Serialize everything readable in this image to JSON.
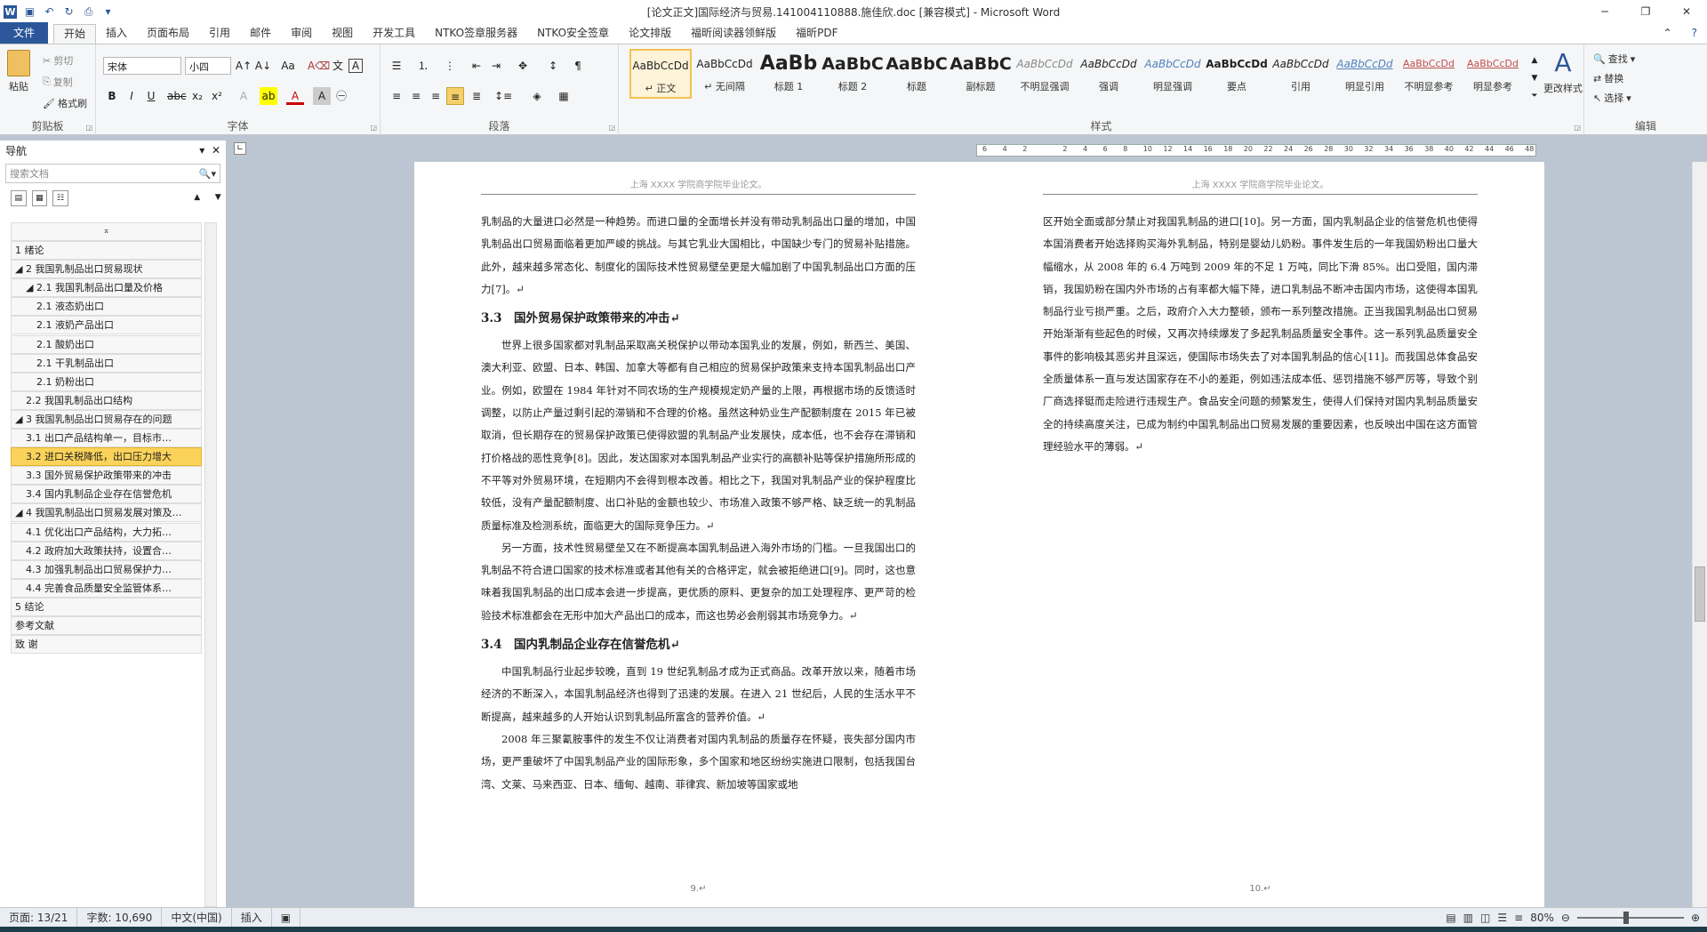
{
  "window": {
    "title": "[论文正文]国际经济与贸易.141004110888.施佳欣.doc [兼容模式] - Microsoft Word",
    "app_icon": "W"
  },
  "tabs": {
    "file": "文件",
    "items": [
      "开始",
      "插入",
      "页面布局",
      "引用",
      "邮件",
      "审阅",
      "视图",
      "开发工具",
      "NTKO签章服务器",
      "NTKO安全签章",
      "论文排版",
      "福昕阅读器领鲜版",
      "福昕PDF"
    ],
    "active_index": 0
  },
  "clipboard": {
    "paste": "粘贴",
    "cut": "剪切",
    "copy": "复制",
    "format_painter": "格式刷",
    "label": "剪贴板"
  },
  "font": {
    "name": "宋体",
    "size": "小四",
    "label": "字体"
  },
  "paragraph": {
    "label": "段落"
  },
  "styles": {
    "label": "样式",
    "items": [
      {
        "preview": "AaBbCcDd",
        "name": "↵ 正文",
        "selected": true
      },
      {
        "preview": "AaBbCcDd",
        "name": "↵ 无间隔",
        "selected": false
      },
      {
        "preview": "AaBb",
        "name": "标题 1",
        "selected": false
      },
      {
        "preview": "AaBbC",
        "name": "标题 2",
        "selected": false
      },
      {
        "preview": "AaBbC",
        "name": "标题",
        "selected": false
      },
      {
        "preview": "AaBbC",
        "name": "副标题",
        "selected": false
      },
      {
        "preview": "AaBbCcDd",
        "name": "不明显强调",
        "selected": false
      },
      {
        "preview": "AaBbCcDd",
        "name": "强调",
        "selected": false
      },
      {
        "preview": "AaBbCcDd",
        "name": "明显强调",
        "selected": false
      },
      {
        "preview": "AaBbCcDd",
        "name": "要点",
        "selected": false
      },
      {
        "preview": "AaBbCcDd",
        "name": "引用",
        "selected": false
      },
      {
        "preview": "AaBbCcDd",
        "name": "明显引用",
        "selected": false
      },
      {
        "preview": "AaBbCcDd",
        "name": "不明显参考",
        "selected": false
      },
      {
        "preview": "AaBbCcDd",
        "name": "明显参考",
        "selected": false
      }
    ],
    "change_styles": "更改样式"
  },
  "editing": {
    "find": "查找",
    "replace": "替换",
    "select": "选择",
    "label": "编辑"
  },
  "ruler": {
    "ticks": [
      "6",
      "4",
      "2",
      "",
      "2",
      "4",
      "6",
      "8",
      "10",
      "12",
      "14",
      "16",
      "18",
      "20",
      "22",
      "24",
      "26",
      "28",
      "30",
      "32",
      "34",
      "36",
      "38",
      "40",
      "42",
      "44",
      "46",
      "48"
    ]
  },
  "nav": {
    "title": "导航",
    "search_placeholder": "搜索文档",
    "items": [
      {
        "text": "1 绪论",
        "level": 1,
        "selected": false
      },
      {
        "text": "◢ 2 我国乳制品出口贸易现状",
        "level": 1,
        "selected": false
      },
      {
        "text": "◢ 2.1 我国乳制品出口量及价格",
        "level": 2,
        "selected": false
      },
      {
        "text": "2.1 液态奶出口",
        "level": 3,
        "selected": false
      },
      {
        "text": "2.1 液奶产品出口",
        "level": 3,
        "selected": false
      },
      {
        "text": "2.1 酸奶出口",
        "level": 3,
        "selected": false
      },
      {
        "text": "2.1 干乳制品出口",
        "level": 3,
        "selected": false
      },
      {
        "text": "2.1 奶粉出口",
        "level": 3,
        "selected": false
      },
      {
        "text": "2.2 我国乳制品出口结构",
        "level": 2,
        "selected": false
      },
      {
        "text": "◢ 3 我国乳制品出口贸易存在的问题",
        "level": 1,
        "selected": false
      },
      {
        "text": "3.1 出口产品结构单一，目标市…",
        "level": 2,
        "selected": false
      },
      {
        "text": "3.2 进口关税降低，出口压力增大",
        "level": 2,
        "selected": true
      },
      {
        "text": "3.3 国外贸易保护政策带来的冲击",
        "level": 2,
        "selected": false
      },
      {
        "text": "3.4 国内乳制品企业存在信誉危机",
        "level": 2,
        "selected": false
      },
      {
        "text": "◢ 4 我国乳制品出口贸易发展对策及…",
        "level": 1,
        "selected": false
      },
      {
        "text": "4.1 优化出口产品结构，大力拓…",
        "level": 2,
        "selected": false
      },
      {
        "text": "4.2 政府加大政策扶持，设置合…",
        "level": 2,
        "selected": false
      },
      {
        "text": "4.3 加强乳制品出口贸易保护力…",
        "level": 2,
        "selected": false
      },
      {
        "text": "4.4 完善食品质量安全监管体系…",
        "level": 2,
        "selected": false
      },
      {
        "text": "5 结论",
        "level": 1,
        "selected": false
      },
      {
        "text": "参考文献",
        "level": 1,
        "selected": false
      },
      {
        "text": "致 谢",
        "level": 1,
        "selected": false
      }
    ]
  },
  "page9": {
    "header": "上海 XXXX 学院商学院毕业论文。",
    "p1": "乳制品的大量进口必然是一种趋势。而进口量的全面增长并没有带动乳制品出口量的增加，中国乳制品出口贸易面临着更加严峻的挑战。与其它乳业大国相比，中国缺少专门的贸易补贴措施。此外，越来越多常态化、制度化的国际技术性贸易壁垒更是大幅加剧了中国乳制品出口方面的压力[7]。↵",
    "h33": "3.3　国外贸易保护政策带来的冲击↵",
    "p2": "世界上很多国家都对乳制品采取高关税保护以带动本国乳业的发展，例如，新西兰、美国、澳大利亚、欧盟、日本、韩国、加拿大等都有自己相应的贸易保护政策来支持本国乳制品出口产业。例如，欧盟在 1984 年针对不同农场的生产规模规定奶产量的上限，再根据市场的反馈适时调整，以防止产量过剩引起的滞销和不合理的价格。虽然这种奶业生产配额制度在 2015 年已被取消，但长期存在的贸易保护政策已使得欧盟的乳制品产业发展快，成本低，也不会存在滞销和打价格战的恶性竞争[8]。因此，发达国家对本国乳制品产业实行的高额补贴等保护措施所形成的不平等对外贸易环境，在短期内不会得到根本改善。相比之下，我国对乳制品产业的保护程度比较低，没有产量配额制度、出口补贴的金额也较少、市场准入政策不够严格、缺乏统一的乳制品质量标准及检测系统，面临更大的国际竞争压力。↵",
    "p3": "另一方面，技术性贸易壁垒又在不断提高本国乳制品进入海外市场的门槛。一旦我国出口的乳制品不符合进口国家的技术标准或者其他有关的合格评定，就会被拒绝进口[9]。同时，这也意味着我国乳制品的出口成本会进一步提高，更优质的原料、更复杂的加工处理程序、更严苛的检验技术标准都会在无形中加大产品出口的成本，而这也势必会削弱其市场竞争力。↵",
    "h34": "3.4　国内乳制品企业存在信誉危机↵",
    "p4": "中国乳制品行业起步较晚，直到 19 世纪乳制品才成为正式商品。改革开放以来，随着市场经济的不断深入，本国乳制品经济也得到了迅速的发展。在进入 21 世纪后，人民的生活水平不断提高，越来越多的人开始认识到乳制品所富含的营养价值。↵",
    "p5": "2008 年三聚氰胺事件的发生不仅让消费者对国内乳制品的质量存在怀疑，丧失部分国内市场，更严重破坏了中国乳制品产业的国际形象，多个国家和地区纷纷实施进口限制，包括我国台湾、文莱、马来西亚、日本、缅甸、越南、菲律宾、新加坡等国家或地",
    "footer": "9.↵"
  },
  "page10": {
    "header": "上海 XXXX 学院商学院毕业论文。",
    "p1": "区开始全面或部分禁止对我国乳制品的进口[10]。另一方面，国内乳制品企业的信誉危机也使得本国消费者开始选择购买海外乳制品，特别是婴幼儿奶粉。事件发生后的一年我国奶粉出口量大幅缩水，从 2008 年的 6.4 万吨到 2009 年的不足 1 万吨，同比下滑 85%。出口受阻，国内滞销，我国奶粉在国内外市场的占有率都大幅下降，进口乳制品不断冲击国内市场，这使得本国乳制品行业亏损严重。之后，政府介入大力整顿，颁布一系列整改措施。正当我国乳制品出口贸易开始渐渐有些起色的时候，又再次持续爆发了多起乳制品质量安全事件。这一系列乳品质量安全事件的影响极其恶劣并且深远，使国际市场失去了对本国乳制品的信心[11]。而我国总体食品安全质量体系一直与发达国家存在不小的差距，例如违法成本低、惩罚措施不够严厉等，导致个别厂商选择铤而走险进行违规生产。食品安全问题的频繁发生，使得人们保持对国内乳制品质量安全的持续高度关注，已成为制约中国乳制品出口贸易发展的重要因素，也反映出中国在这方面管理经验水平的薄弱。↵",
    "footer": "10.↵"
  },
  "status": {
    "page": "页面: 13/21",
    "words": "字数: 10,690",
    "lang": "中文(中国)",
    "mode": "插入",
    "zoom": "80%"
  }
}
